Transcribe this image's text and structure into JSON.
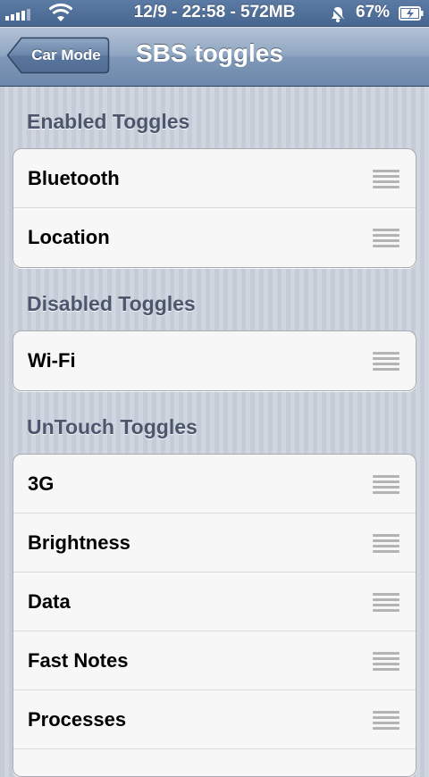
{
  "status_bar": {
    "center_text": "12/9 - 22:58 - 572MB",
    "battery_percent": "67%",
    "signal_icon": "signal-bars-icon",
    "wifi_icon": "wifi-icon",
    "silent_icon": "bell-muted-icon",
    "battery_icon": "battery-charging-icon"
  },
  "nav": {
    "back_label": "Car Mode",
    "title": "SBS toggles"
  },
  "sections": {
    "enabled": {
      "header": "Enabled Toggles",
      "items": [
        "Bluetooth",
        "Location"
      ]
    },
    "disabled": {
      "header": "Disabled Toggles",
      "items": [
        "Wi-Fi"
      ]
    },
    "untouch": {
      "header": "UnTouch Toggles",
      "items": [
        "3G",
        "Brightness",
        "Data",
        "Fast Notes",
        "Processes"
      ]
    }
  },
  "colors": {
    "navbar": "#7f98b8",
    "background": "#cbd2dc",
    "section_header_text": "#4c566c"
  }
}
